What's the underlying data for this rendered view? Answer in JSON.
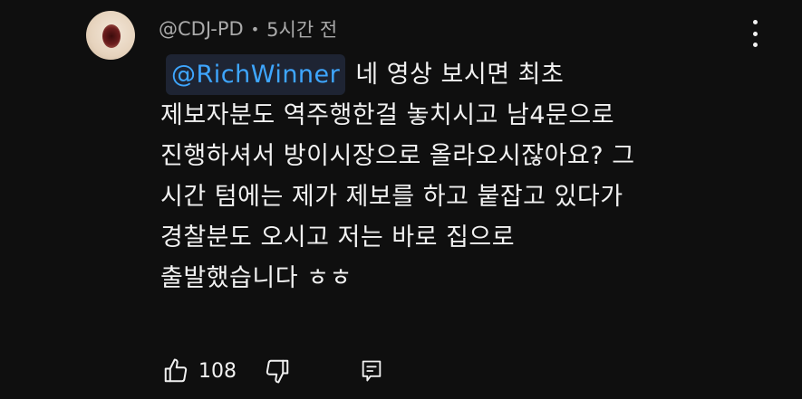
{
  "comment": {
    "author": "@CDJ-PD",
    "separator": "•",
    "time": "5시간 전",
    "mention": "@RichWinner",
    "lines": [
      "네 영상 보시면 최초",
      "제보자분도 역주행한걸 놓치시고 남4문으로",
      "진행하셔서 방이시장으로 올라오시잖아요? 그",
      "시간 텀에는 제가 제보를 하고 붙잡고 있다가",
      "경찰분도 오시고 저는 바로 집으로",
      "출발했습니다 ㅎㅎ"
    ],
    "like_count": "108"
  },
  "icons": {
    "like": "thumbs-up-icon",
    "dislike": "thumbs-down-icon",
    "reply": "reply-comment-icon",
    "menu": "more-vert-icon"
  },
  "colors": {
    "background": "#0f0f0f",
    "text": "#f1f1f1",
    "secondary_text": "#aaaaaa",
    "mention": "#3ea6ff",
    "mention_bg": "#1e2433"
  }
}
